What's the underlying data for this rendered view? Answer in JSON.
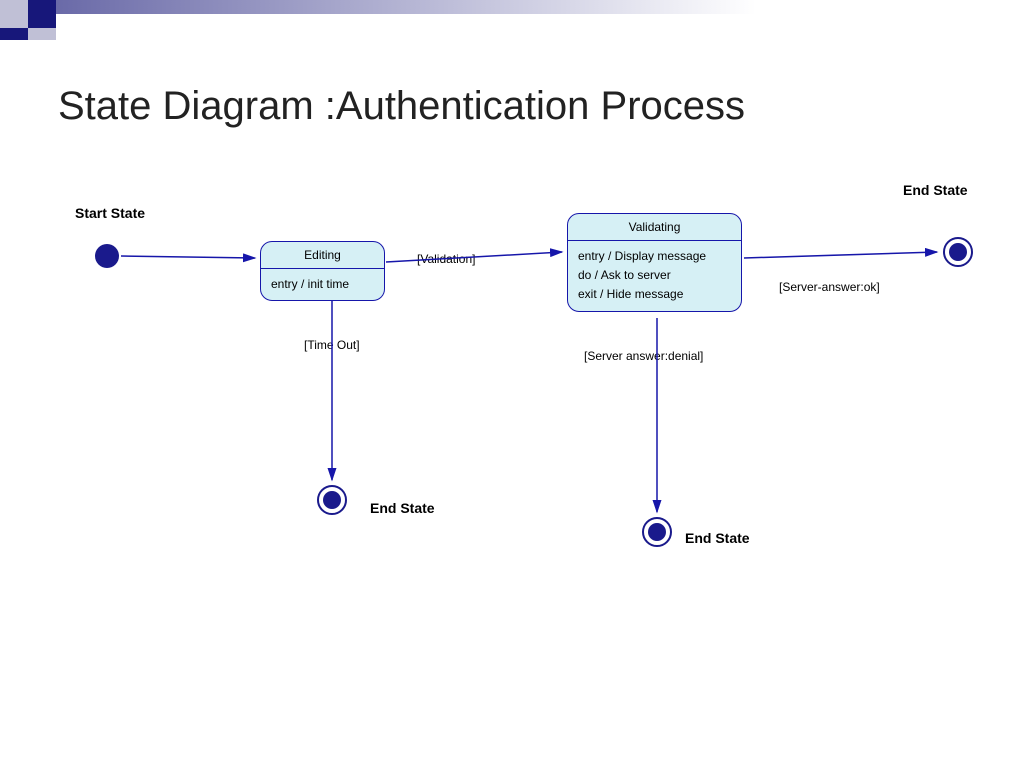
{
  "title": "State Diagram :Authentication Process",
  "labels": {
    "start": "Start State",
    "end1": "End State",
    "end2": "End State",
    "end3": "End State"
  },
  "states": {
    "editing": {
      "name": "Editing",
      "entry": "entry / init time"
    },
    "validating": {
      "name": "Validating",
      "entry": "entry / Display message",
      "do": "do / Ask to server",
      "exit": "exit / Hide message"
    }
  },
  "transitions": {
    "validation": "[Validation]",
    "timeout": "[Time Out]",
    "denial": "[Server answer:denial]",
    "ok": "[Server-answer:ok]"
  }
}
